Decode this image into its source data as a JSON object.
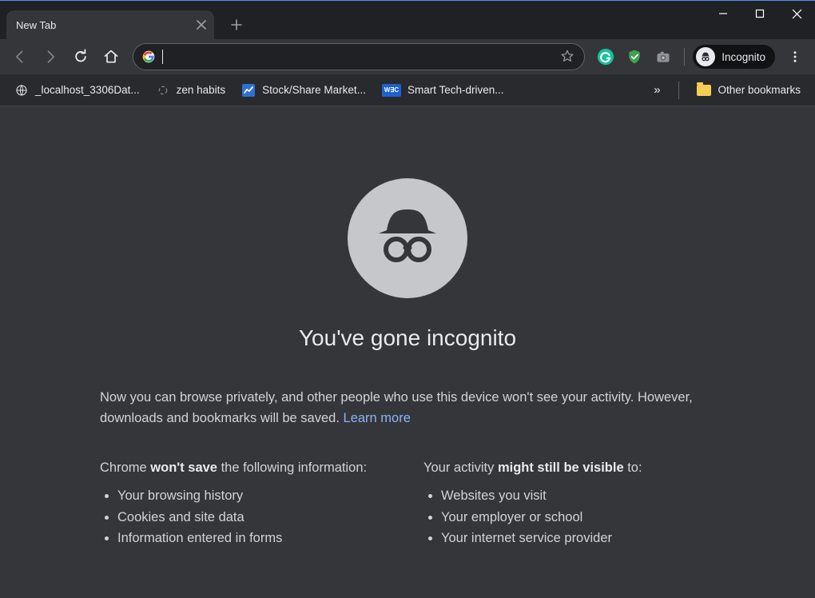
{
  "window": {
    "tab_title": "New Tab"
  },
  "toolbar": {
    "omnibox_value": "",
    "incognito_label": "Incognito"
  },
  "extensions": [
    {
      "name": "grammarly-icon",
      "color": "#15c39a",
      "glyph": "G"
    },
    {
      "name": "shield-icon",
      "color": "#3fa34d",
      "glyph": ""
    },
    {
      "name": "camera-icon",
      "color": "#9aa0a6",
      "glyph": ""
    }
  ],
  "bookmarks": [
    {
      "label": "_localhost_3306Dat...",
      "icon": "globe"
    },
    {
      "label": "zen habits",
      "icon": "spinner"
    },
    {
      "label": "Stock/Share Market...",
      "icon": "mc"
    },
    {
      "label": "Smart Tech-driven...",
      "icon": "wec"
    }
  ],
  "bookmarks_overflow_glyph": "»",
  "other_bookmarks_label": "Other bookmarks",
  "page": {
    "heading": "You've gone incognito",
    "intro_1": "Now you can browse privately, and other people who use this device won't see your activity. However, downloads and bookmarks will be saved. ",
    "learn_more": "Learn more",
    "left_head_pre": "Chrome ",
    "left_head_bold": "won't save",
    "left_head_post": " the following information:",
    "left_items": [
      "Your browsing history",
      "Cookies and site data",
      "Information entered in forms"
    ],
    "right_head_pre": "Your activity ",
    "right_head_bold": "might still be visible",
    "right_head_post": " to:",
    "right_items": [
      "Websites you visit",
      "Your employer or school",
      "Your internet service provider"
    ]
  }
}
